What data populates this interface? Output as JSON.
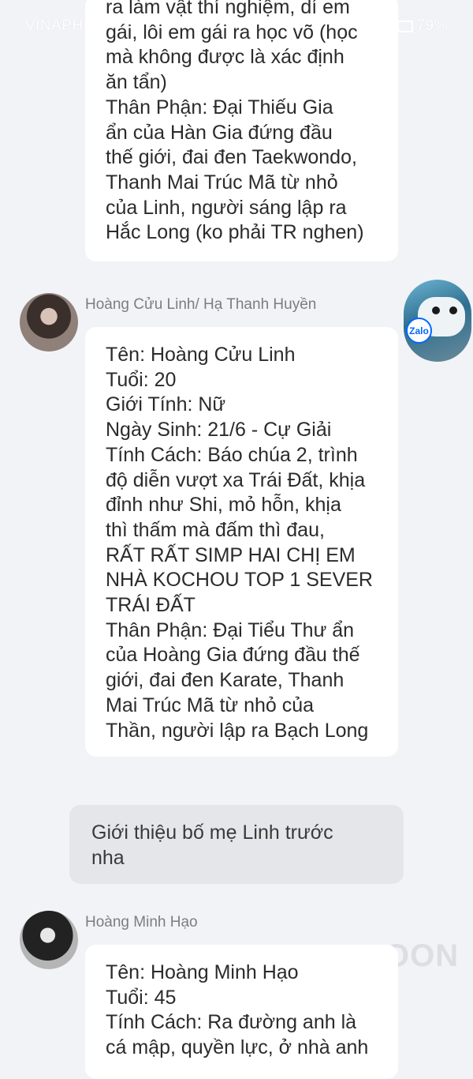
{
  "status_bar": {
    "carrier": "VINAPH",
    "battery": "79%"
  },
  "messages": [
    {
      "id": "msg1",
      "lines": [
        "ra làm vật thí nghiệm, dí em",
        "gái, lôi em gái ra học võ (học",
        "mà không được là xác định",
        "ăn tẩn)",
        "Thân Phận: Đại Thiếu Gia",
        "ẩn của Hàn Gia đứng đầu",
        "thế giới, đai đen Taekwondo,",
        "Thanh Mai Trúc Mã từ nhỏ",
        "của Linh, người sáng lập ra",
        "Hắc Long (ko phải TR nghen)"
      ]
    },
    {
      "id": "msg2",
      "sender": "Hoàng Cửu Linh/ Hạ Thanh Huyền",
      "lines": [
        "Tên: Hoàng Cửu Linh",
        "Tuổi: 20",
        "Giới Tính: Nữ",
        "Ngày Sinh: 21/6 - Cự Giải",
        "Tính Cách: Báo chúa 2, trình",
        "độ diễn vượt xa Trái Đất, khịa",
        "đỉnh như Shi, mỏ hỗn, khịa",
        "thì thấm mà đấm thì đau,",
        "RẤT RẤT SIMP HAI CHỊ EM",
        "NHÀ KOCHOU TOP 1 SEVER",
        "TRÁI ĐẤT",
        "Thân Phận: Đại Tiểu Thư ẩn",
        "của Hoàng Gia đứng đầu thế",
        "giới, đai đen Karate, Thanh",
        "Mai Trúc Mã từ nhỏ của",
        "Thần, người lập ra Bạch Long"
      ]
    },
    {
      "id": "sent1",
      "lines": [
        "Giới thiệu bố mẹ Linh trước",
        "nha"
      ]
    },
    {
      "id": "msg3",
      "sender": "Hoàng Minh Hạo",
      "lines": [
        "Tên: Hoàng Minh Hạo",
        "Tuổi: 45",
        "Tính Cách: Ra đường anh là",
        "cá mập, quyền lực, ở nhà anh"
      ]
    }
  ],
  "overlay": {
    "zalo_label": "Zalo",
    "watermark": "OON"
  }
}
